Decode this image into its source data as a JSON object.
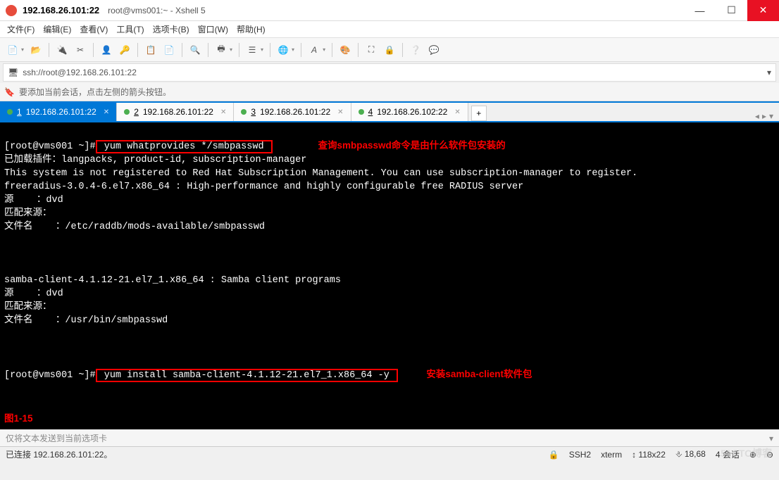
{
  "titlebar": {
    "title": "192.168.26.101:22",
    "subtitle": "root@vms001:~ - Xshell 5"
  },
  "menubar": {
    "file": "文件(F)",
    "edit": "编辑(E)",
    "view": "查看(V)",
    "tools": "工具(T)",
    "tabs": "选项卡(B)",
    "window": "窗口(W)",
    "help": "帮助(H)"
  },
  "addressbar": {
    "url": "ssh://root@192.168.26.101:22"
  },
  "hintbar": {
    "text": "要添加当前会话，点击左侧的箭头按钮。"
  },
  "tabs": [
    {
      "num": "1",
      "label": "192.168.26.101:22",
      "active": true
    },
    {
      "num": "2",
      "label": "192.168.26.101:22",
      "active": false
    },
    {
      "num": "3",
      "label": "192.168.26.101:22",
      "active": false
    },
    {
      "num": "4",
      "label": "192.168.26.102:22",
      "active": false
    }
  ],
  "terminal": {
    "prompt1": "[root@vms001 ~]#",
    "cmd1": " yum whatprovides */smbpasswd ",
    "ann1": "查询smbpasswd命令是由什么软件包安装的",
    "line_plugins": "已加载插件：langpacks, product-id, subscription-manager",
    "line_register": "This system is not registered to Red Hat Subscription Management. You can use subscription-manager to register.",
    "line_freeradius": "freeradius-3.0.4-6.el7.x86_64 : High-performance and highly configurable free RADIUS server",
    "line_src1": "源    ：dvd",
    "line_match1": "匹配来源：",
    "line_file1": "文件名    ：/etc/raddb/mods-available/smbpasswd",
    "line_samba": "samba-client-4.1.12-21.el7_1.x86_64 : Samba client programs",
    "line_src2": "源    ：dvd",
    "line_match2": "匹配来源：",
    "line_file2": "文件名    ：/usr/bin/smbpasswd",
    "prompt2": "[root@vms001 ~]#",
    "cmd2": " yum install samba-client-4.1.12-21.el7_1.x86_64 -y ",
    "ann2": "安装samba-client软件包",
    "figure": "图1-15"
  },
  "inputstrip": {
    "placeholder": "仅将文本发送到当前选项卡"
  },
  "statusbar": {
    "left": "已连接 192.168.26.101:22。",
    "ssh": "SSH2",
    "term": "xterm",
    "size": "118x22",
    "pos": "18,68",
    "sessions": "4 会话"
  },
  "watermark": "51CTO博客"
}
